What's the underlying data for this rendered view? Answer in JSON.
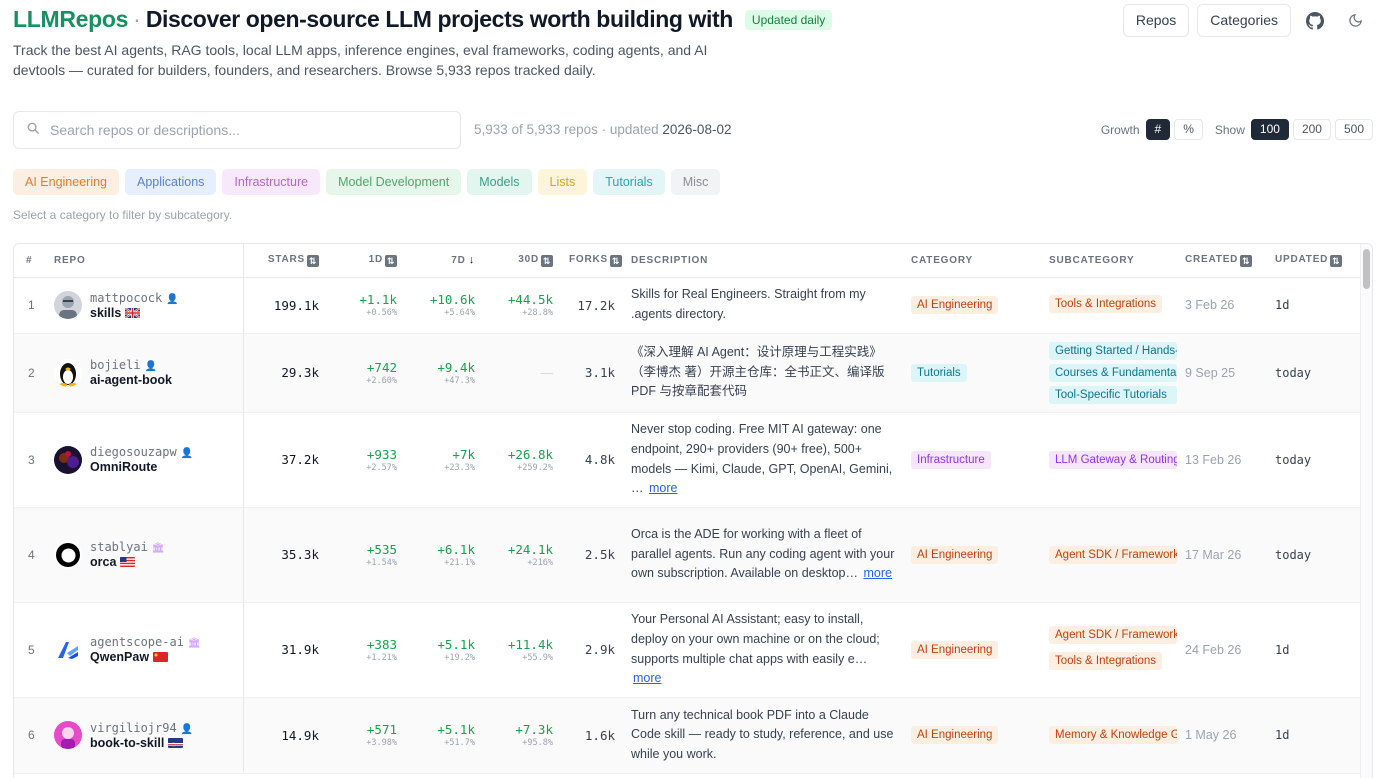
{
  "header": {
    "brand": "LLMRepos",
    "separator": "·",
    "headline": "Discover open-source LLM projects worth building with",
    "badge": "Updated daily",
    "subtitle": "Track the best AI agents, RAG tools, local LLM apps, inference engines, eval frameworks, coding agents, and AI devtools — curated for builders, founders, and researchers. Browse 5,933 repos tracked daily.",
    "nav": {
      "repos": "Repos",
      "categories": "Categories"
    },
    "icons": {
      "github": "github-icon",
      "theme": "moon-icon"
    }
  },
  "search": {
    "placeholder": "Search repos or descriptions...",
    "value": "",
    "count_text": "5,933 of 5,933 repos · updated ",
    "updated_date": "2026-08-02"
  },
  "controls": {
    "growth_label": "Growth",
    "growth_options": [
      "#",
      "%"
    ],
    "growth_selected": "#",
    "show_label": "Show",
    "show_options": [
      "100",
      "200",
      "500"
    ],
    "show_selected": "100"
  },
  "categories": [
    {
      "label": "AI Engineering",
      "bg": "#fdeee2",
      "fg": "#ea7a2e"
    },
    {
      "label": "Applications",
      "bg": "#e6efff",
      "fg": "#5b7fd6"
    },
    {
      "label": "Infrastructure",
      "bg": "#f7e9fb",
      "fg": "#b366cc"
    },
    {
      "label": "Model Development",
      "bg": "#e7f6ea",
      "fg": "#4fa56b"
    },
    {
      "label": "Models",
      "bg": "#e2f6ef",
      "fg": "#3a9e86"
    },
    {
      "label": "Lists",
      "bg": "#fdf5d9",
      "fg": "#d4a52a"
    },
    {
      "label": "Tutorials",
      "bg": "#e2f6f8",
      "fg": "#30a2b3"
    },
    {
      "label": "Misc",
      "bg": "#f2f3f5",
      "fg": "#8a8f98"
    }
  ],
  "category_hint": "Select a category to filter by subcategory.",
  "table": {
    "columns": {
      "rank": "#",
      "repo": "Repo",
      "stars": "Stars",
      "d1": "1D",
      "d7": "7D",
      "d30": "30D",
      "forks": "Forks",
      "description": "Description",
      "category": "Category",
      "subcategory": "Subcategory",
      "created": "Created",
      "updated": "Updated"
    },
    "more_label": "more",
    "rows": [
      {
        "rank": "1",
        "owner": "mattpocock",
        "owner_type": "user",
        "name": "skills",
        "flag": "gb",
        "avatar": "person",
        "stars": "199.1k",
        "d1": "+1.1k",
        "d1p": "+0.56%",
        "d7": "+10.6k",
        "d7p": "+5.64%",
        "d30": "+44.5k",
        "d30p": "+28.8%",
        "forks": "17.2k",
        "description": "Skills for Real Engineers. Straight from my .agents directory.",
        "truncated": false,
        "category": "AI Engineering",
        "cat_bg": "#fdeee2",
        "cat_fg": "#c2410c",
        "subcategories": [
          "Tools & Integrations"
        ],
        "sub_bg": "#fdeee2",
        "sub_fg": "#c2410c",
        "created": "3 Feb 26",
        "updated": "1d"
      },
      {
        "rank": "2",
        "owner": "bojieli",
        "owner_type": "user",
        "name": "ai-agent-book",
        "flag": "",
        "avatar": "penguin",
        "stars": "29.3k",
        "d1": "+742",
        "d1p": "+2.60%",
        "d7": "+9.4k",
        "d7p": "+47.3%",
        "d30": "—",
        "d30p": "",
        "forks": "3.1k",
        "description": "《深入理解 AI Agent：设计原理与工程实践》（李博杰 著）开源主仓库：全书正文、编译版 PDF 与按章配套代码",
        "truncated": false,
        "category": "Tutorials",
        "cat_bg": "#dcf5f8",
        "cat_fg": "#0e7490",
        "subcategories": [
          "Getting Started / Hands-on",
          "Courses & Fundamentals",
          "Tool-Specific Tutorials"
        ],
        "sub_bg": "#dcf5f8",
        "sub_fg": "#0e7490",
        "created": "9 Sep 25",
        "updated": "today"
      },
      {
        "rank": "3",
        "owner": "diegosouzapw",
        "owner_type": "user",
        "name": "OmniRoute",
        "flag": "",
        "avatar": "dark",
        "stars": "37.2k",
        "d1": "+933",
        "d1p": "+2.57%",
        "d7": "+7k",
        "d7p": "+23.3%",
        "d30": "+26.8k",
        "d30p": "+259.2%",
        "forks": "4.8k",
        "description": "Never stop coding. Free MIT AI gateway: one endpoint, 290+ providers (90+ free), 500+ models — Kimi, Claude, GPT, OpenAI, Gemini, …",
        "truncated": true,
        "category": "Infrastructure",
        "cat_bg": "#f5e6fb",
        "cat_fg": "#9333ea",
        "subcategories": [
          "LLM Gateway & Routing"
        ],
        "sub_bg": "#f5e6fb",
        "sub_fg": "#9333ea",
        "created": "13 Feb 26",
        "updated": "today"
      },
      {
        "rank": "4",
        "owner": "stablyai",
        "owner_type": "org",
        "name": "orca",
        "flag": "us",
        "avatar": "ring",
        "stars": "35.3k",
        "d1": "+535",
        "d1p": "+1.54%",
        "d7": "+6.1k",
        "d7p": "+21.1%",
        "d30": "+24.1k",
        "d30p": "+216%",
        "forks": "2.5k",
        "description": "Orca is the ADE for working with a fleet of parallel agents. Run any coding agent with your own subscription. Available on desktop…",
        "truncated": true,
        "category": "AI Engineering",
        "cat_bg": "#fdeee2",
        "cat_fg": "#c2410c",
        "subcategories": [
          "Agent SDK / Frameworks"
        ],
        "sub_bg": "#fdeee2",
        "sub_fg": "#c2410c",
        "created": "17 Mar 26",
        "updated": "today"
      },
      {
        "rank": "5",
        "owner": "agentscope-ai",
        "owner_type": "org",
        "name": "QwenPaw",
        "flag": "cn",
        "avatar": "logo",
        "stars": "31.9k",
        "d1": "+383",
        "d1p": "+1.21%",
        "d7": "+5.1k",
        "d7p": "+19.2%",
        "d30": "+11.4k",
        "d30p": "+55.9%",
        "forks": "2.9k",
        "description": "Your Personal AI Assistant; easy to install, deploy on your own machine or on the cloud; supports multiple chat apps with easily e…",
        "truncated": true,
        "category": "AI Engineering",
        "cat_bg": "#fdeee2",
        "cat_fg": "#c2410c",
        "subcategories": [
          "Agent SDK / Frameworks",
          "Tools & Integrations"
        ],
        "sub_bg": "#fdeee2",
        "sub_fg": "#c2410c",
        "created": "24 Feb 26",
        "updated": "1d"
      },
      {
        "rank": "6",
        "owner": "virgiliojr94",
        "owner_type": "user",
        "name": "book-to-skill",
        "flag": "cv",
        "avatar": "pink",
        "stars": "14.9k",
        "d1": "+571",
        "d1p": "+3.98%",
        "d7": "+5.1k",
        "d7p": "+51.7%",
        "d30": "+7.3k",
        "d30p": "+95.8%",
        "forks": "1.6k",
        "description": "Turn any technical book PDF into a Claude Code skill — ready to study, reference, and use while you work.",
        "truncated": false,
        "category": "AI Engineering",
        "cat_bg": "#fdeee2",
        "cat_fg": "#c2410c",
        "subcategories": [
          "Memory & Knowledge Graphs"
        ],
        "sub_bg": "#fdeee2",
        "sub_fg": "#c2410c",
        "created": "1 May 26",
        "updated": "1d"
      }
    ]
  }
}
